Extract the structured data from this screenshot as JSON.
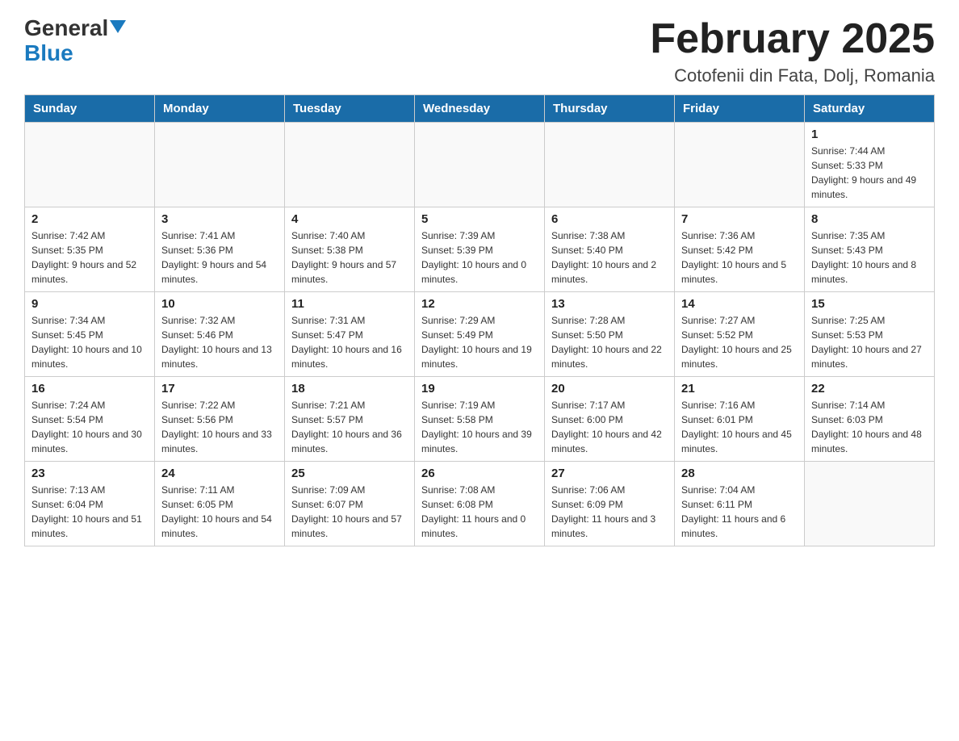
{
  "header": {
    "logo_main": "General",
    "logo_sub": "Blue",
    "month_title": "February 2025",
    "location": "Cotofenii din Fata, Dolj, Romania"
  },
  "days_of_week": [
    "Sunday",
    "Monday",
    "Tuesday",
    "Wednesday",
    "Thursday",
    "Friday",
    "Saturday"
  ],
  "weeks": [
    [
      {
        "day": "",
        "info": ""
      },
      {
        "day": "",
        "info": ""
      },
      {
        "day": "",
        "info": ""
      },
      {
        "day": "",
        "info": ""
      },
      {
        "day": "",
        "info": ""
      },
      {
        "day": "",
        "info": ""
      },
      {
        "day": "1",
        "info": "Sunrise: 7:44 AM\nSunset: 5:33 PM\nDaylight: 9 hours and 49 minutes."
      }
    ],
    [
      {
        "day": "2",
        "info": "Sunrise: 7:42 AM\nSunset: 5:35 PM\nDaylight: 9 hours and 52 minutes."
      },
      {
        "day": "3",
        "info": "Sunrise: 7:41 AM\nSunset: 5:36 PM\nDaylight: 9 hours and 54 minutes."
      },
      {
        "day": "4",
        "info": "Sunrise: 7:40 AM\nSunset: 5:38 PM\nDaylight: 9 hours and 57 minutes."
      },
      {
        "day": "5",
        "info": "Sunrise: 7:39 AM\nSunset: 5:39 PM\nDaylight: 10 hours and 0 minutes."
      },
      {
        "day": "6",
        "info": "Sunrise: 7:38 AM\nSunset: 5:40 PM\nDaylight: 10 hours and 2 minutes."
      },
      {
        "day": "7",
        "info": "Sunrise: 7:36 AM\nSunset: 5:42 PM\nDaylight: 10 hours and 5 minutes."
      },
      {
        "day": "8",
        "info": "Sunrise: 7:35 AM\nSunset: 5:43 PM\nDaylight: 10 hours and 8 minutes."
      }
    ],
    [
      {
        "day": "9",
        "info": "Sunrise: 7:34 AM\nSunset: 5:45 PM\nDaylight: 10 hours and 10 minutes."
      },
      {
        "day": "10",
        "info": "Sunrise: 7:32 AM\nSunset: 5:46 PM\nDaylight: 10 hours and 13 minutes."
      },
      {
        "day": "11",
        "info": "Sunrise: 7:31 AM\nSunset: 5:47 PM\nDaylight: 10 hours and 16 minutes."
      },
      {
        "day": "12",
        "info": "Sunrise: 7:29 AM\nSunset: 5:49 PM\nDaylight: 10 hours and 19 minutes."
      },
      {
        "day": "13",
        "info": "Sunrise: 7:28 AM\nSunset: 5:50 PM\nDaylight: 10 hours and 22 minutes."
      },
      {
        "day": "14",
        "info": "Sunrise: 7:27 AM\nSunset: 5:52 PM\nDaylight: 10 hours and 25 minutes."
      },
      {
        "day": "15",
        "info": "Sunrise: 7:25 AM\nSunset: 5:53 PM\nDaylight: 10 hours and 27 minutes."
      }
    ],
    [
      {
        "day": "16",
        "info": "Sunrise: 7:24 AM\nSunset: 5:54 PM\nDaylight: 10 hours and 30 minutes."
      },
      {
        "day": "17",
        "info": "Sunrise: 7:22 AM\nSunset: 5:56 PM\nDaylight: 10 hours and 33 minutes."
      },
      {
        "day": "18",
        "info": "Sunrise: 7:21 AM\nSunset: 5:57 PM\nDaylight: 10 hours and 36 minutes."
      },
      {
        "day": "19",
        "info": "Sunrise: 7:19 AM\nSunset: 5:58 PM\nDaylight: 10 hours and 39 minutes."
      },
      {
        "day": "20",
        "info": "Sunrise: 7:17 AM\nSunset: 6:00 PM\nDaylight: 10 hours and 42 minutes."
      },
      {
        "day": "21",
        "info": "Sunrise: 7:16 AM\nSunset: 6:01 PM\nDaylight: 10 hours and 45 minutes."
      },
      {
        "day": "22",
        "info": "Sunrise: 7:14 AM\nSunset: 6:03 PM\nDaylight: 10 hours and 48 minutes."
      }
    ],
    [
      {
        "day": "23",
        "info": "Sunrise: 7:13 AM\nSunset: 6:04 PM\nDaylight: 10 hours and 51 minutes."
      },
      {
        "day": "24",
        "info": "Sunrise: 7:11 AM\nSunset: 6:05 PM\nDaylight: 10 hours and 54 minutes."
      },
      {
        "day": "25",
        "info": "Sunrise: 7:09 AM\nSunset: 6:07 PM\nDaylight: 10 hours and 57 minutes."
      },
      {
        "day": "26",
        "info": "Sunrise: 7:08 AM\nSunset: 6:08 PM\nDaylight: 11 hours and 0 minutes."
      },
      {
        "day": "27",
        "info": "Sunrise: 7:06 AM\nSunset: 6:09 PM\nDaylight: 11 hours and 3 minutes."
      },
      {
        "day": "28",
        "info": "Sunrise: 7:04 AM\nSunset: 6:11 PM\nDaylight: 11 hours and 6 minutes."
      },
      {
        "day": "",
        "info": ""
      }
    ]
  ]
}
